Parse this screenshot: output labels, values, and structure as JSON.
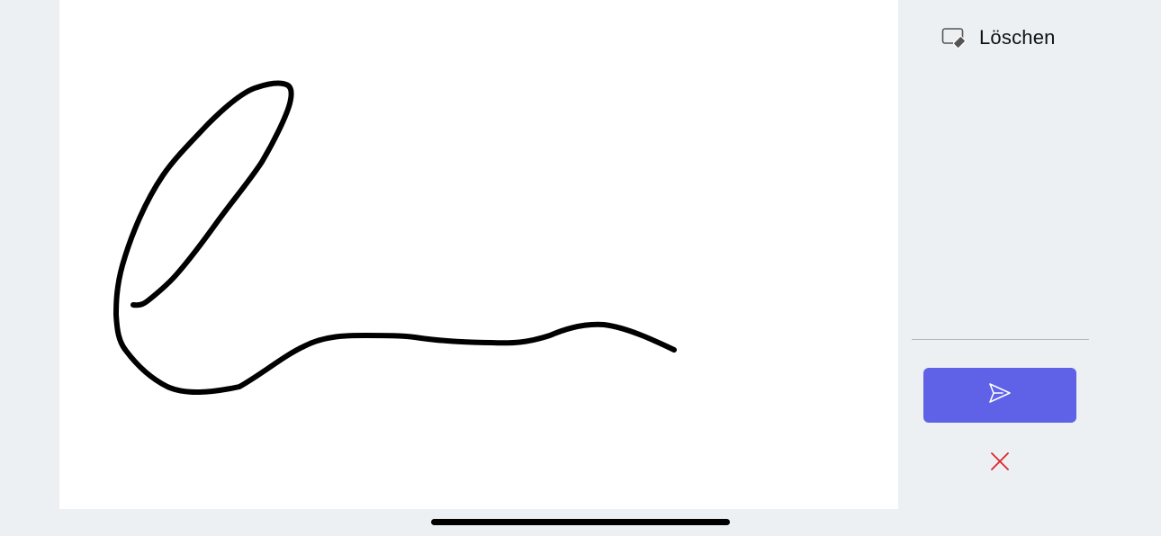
{
  "toolbar": {
    "clear_label": "Löschen",
    "clear_icon": "eraser-icon",
    "send_icon": "send-icon",
    "cancel_icon": "close-icon"
  },
  "colors": {
    "background": "#ecf0f3",
    "canvas": "#ffffff",
    "stroke": "#000000",
    "send_button": "#5f62e6",
    "cancel_icon": "#e0242a"
  }
}
